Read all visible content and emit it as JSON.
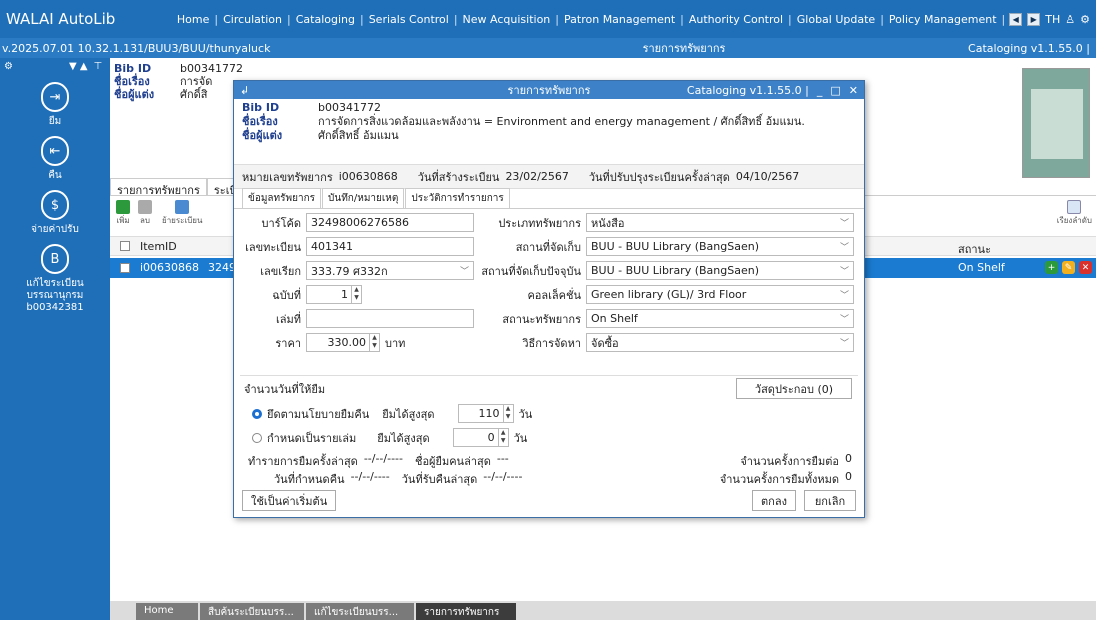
{
  "app": {
    "brand": "WALAI AutoLib",
    "menu": [
      "Home",
      "Circulation",
      "Cataloging",
      "Serials Control",
      "New Acquisition",
      "Patron Management",
      "Authority Control",
      "Global Update",
      "Policy Management"
    ],
    "lang": "TH"
  },
  "subbar": {
    "left": "v.2025.07.01   10.32.1.131/BUU3/BUU/thunyaluck",
    "center": "รายการทรัพยากร",
    "right": "Cataloging v1.1.55.0 |"
  },
  "sidebar": {
    "items": [
      {
        "label": "ยืม",
        "icon": "borrow-icon"
      },
      {
        "label": "คืน",
        "icon": "return-icon"
      },
      {
        "label": "จ่ายค่าปรับ",
        "icon": "fine-icon"
      },
      {
        "label": "แก้ไขระเบียน\nบรรณานุกรม\nb00342381",
        "icon": "edit-record-icon"
      }
    ]
  },
  "background": {
    "bib_id_label": "Bib ID",
    "bib_id": "b00341772",
    "title_label": "ชื่อเรื่อง",
    "title": "การจัด",
    "author_label": "ชื่อผู้แต่ง",
    "author": "ศักดิ์สิ",
    "tabs": [
      "รายการทรัพยากร",
      "ระเบีย"
    ],
    "tools": [
      "เพิ่ม",
      "ลบ",
      "ย้ายระเบียน"
    ],
    "sort_label": "เรียงลำดับ",
    "col_item": "ItemID",
    "col_status": "สถานะ",
    "row": {
      "item_id": "i00630868",
      "barcode_part": "3249",
      "status": "On Shelf"
    }
  },
  "bottom_tabs": [
    "Home",
    "สืบค้นระเบียนบรร...",
    "แก้ไขระเบียนบรร...",
    "รายการทรัพยากร"
  ],
  "dialog": {
    "title": "รายการทรัพยากร",
    "version": "Cataloging v1.1.55.0 |",
    "bib_id_label": "Bib ID",
    "bib_id": "b00341772",
    "title_label": "ชื่อเรื่อง",
    "title_value": "การจัดการสิ่งแวดล้อมและพลังงาน = Environment and energy management / ศักดิ์สิทธิ์ อ้มแมน.",
    "author_label": "ชื่อผู้แต่ง",
    "author_value": "ศักดิ์สิทธิ์ อ้มแมน",
    "reg": {
      "item_label": "หมายเลขทรัพยากร",
      "item_value": "i00630868",
      "created_label": "วันที่สร้างระเบียน",
      "created_value": "23/02/2567",
      "updated_label": "วันที่ปรับปรุงระเบียนครั้งล่าสุด",
      "updated_value": "04/10/2567"
    },
    "tabs": [
      "ข้อมูลทรัพยากร",
      "บันทึก/หมายเหตุ",
      "ประวัติการทำรายการ"
    ],
    "form": {
      "barcode_label": "บาร์โค้ด",
      "barcode": "32498006276586",
      "regno_label": "เลขทะเบียน",
      "regno": "401341",
      "callno_label": "เลขเรียก",
      "callno": "333.79 ศ332ก",
      "copy_label": "ฉบับที่",
      "copy": "1",
      "volume_label": "เล่มที่",
      "volume": "",
      "price_label": "ราคา",
      "price": "330.00",
      "price_unit": "บาท",
      "type_label": "ประเภททรัพยากร",
      "type": "หนังสือ",
      "location_label": "สถานที่จัดเก็บ",
      "location": "BUU - BUU Library (BangSaen)",
      "curloc_label": "สถานที่จัดเก็บปัจจุบัน",
      "curloc": "BUU - BUU Library (BangSaen)",
      "collection_label": "คอลเล็คชั่น",
      "collection": "Green library (GL)/ 3rd Floor",
      "status_label": "สถานะทรัพยากร",
      "status": "On Shelf",
      "acq_label": "วิธีการจัดหา",
      "acq": "จัดซื้อ"
    },
    "loan": {
      "heading": "จำนวนวันที่ให้ยืม",
      "materials_btn": "วัสดุประกอบ (0)",
      "opt1": "ยึดตามนโยบายยืมคืน",
      "opt1_max_label": "ยืมได้สูงสุด",
      "opt1_max": "110",
      "opt1_unit": "วัน",
      "opt2": "กำหนดเป็นรายเล่ม",
      "opt2_max_label": "ยืมได้สูงสุด",
      "opt2_max": "0",
      "opt2_unit": "วัน",
      "last_loan_label": "ทำรายการยืมครั้งล่าสุด",
      "last_loan": "--/--/----",
      "last_borrower_label": "ชื่อผู้ยืมคนล่าสุด",
      "last_borrower": "---",
      "renew_count_label": "จำนวนครั้งการยืมต่อ",
      "renew_count": "0",
      "due_label": "วันที่กำหนดคืน",
      "due": "--/--/----",
      "last_return_label": "วันที่รับคืนล่าสุด",
      "last_return": "--/--/----",
      "total_label": "จำนวนครั้งการยืมทั้งหมด",
      "total": "0"
    },
    "default_btn": "ใช้เป็นค่าเริ่มต้น",
    "ok_btn": "ตกลง",
    "cancel_btn": "ยกเลิก"
  }
}
